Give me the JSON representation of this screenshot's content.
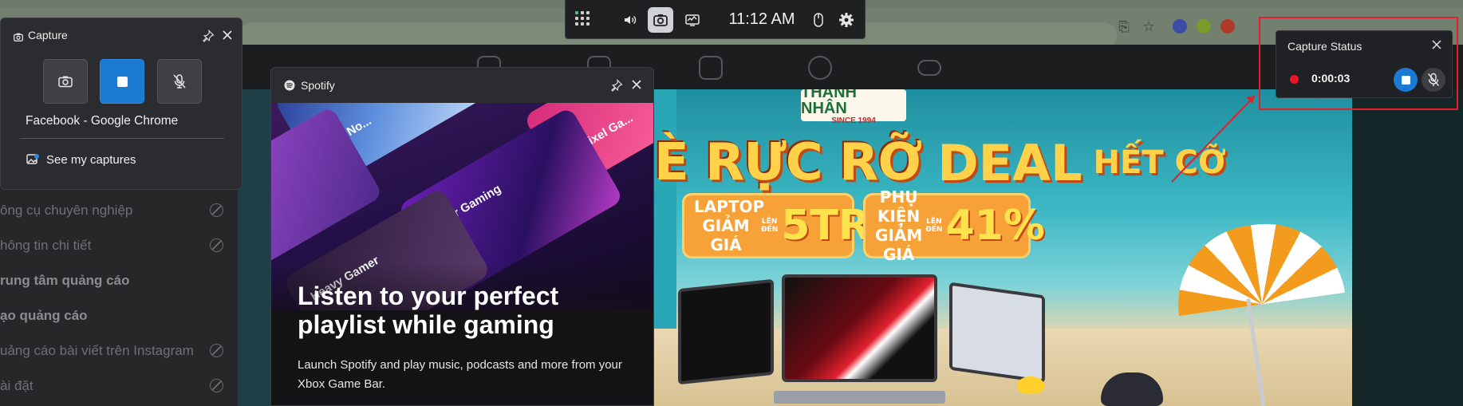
{
  "gamebar": {
    "time": "11:12 AM",
    "icons": [
      "widget-menu-icon",
      "volume-icon",
      "capture-camera-icon",
      "performance-icon",
      "mouse-icon",
      "settings-gear-icon"
    ]
  },
  "capture_widget": {
    "title": "Capture",
    "source": "Facebook - Google Chrome",
    "see_captures": "See my captures",
    "buttons": [
      "screenshot-button",
      "stop-record-button",
      "mic-off-button"
    ],
    "accent": "#1b7ad2"
  },
  "spotify_widget": {
    "title": "Spotify",
    "art_labels": [
      "No...",
      "Pixel Ga...",
      "Power Gaming",
      "Heavy Gamer"
    ],
    "headline": "Listen to your perfect playlist while gaming",
    "description": "Launch Spotify and play music, podcasts and more from your Xbox Game Bar."
  },
  "capture_status": {
    "title": "Capture Status",
    "elapsed": "0:00:03",
    "recording_color": "#e8162a",
    "highlight_color": "#e0202c"
  },
  "facebook": {
    "sidebar": [
      {
        "label": "ông cụ chuyên nghiệp",
        "bold": false,
        "restricted": true
      },
      {
        "label": "hông tin chi tiết",
        "bold": false,
        "restricted": true
      },
      {
        "label": "rung tâm quảng cáo",
        "bold": true,
        "restricted": false
      },
      {
        "label": "ạo quảng cáo",
        "bold": true,
        "restricted": false
      },
      {
        "label": "uảng cáo bài viết trên Instagram",
        "bold": false,
        "restricted": true
      },
      {
        "label": "ài đặt",
        "bold": false,
        "restricted": true
      }
    ],
    "banner": {
      "brand": "THÀNH NHÂN",
      "since": "SINCE 1994",
      "headline_a": "È RỰC RỠ",
      "headline_b": "DEAL",
      "headline_c": "HẾT CỠ",
      "promo1_label": "LAPTOP GIẢM GIÁ",
      "promo1_small": "LÊN ĐẾN",
      "promo1_value": "5TR",
      "promo2_label": "PHỤ KIỆN GIẢM GIÁ",
      "promo2_small": "LÊN ĐẾN",
      "promo2_value": "41%"
    }
  }
}
